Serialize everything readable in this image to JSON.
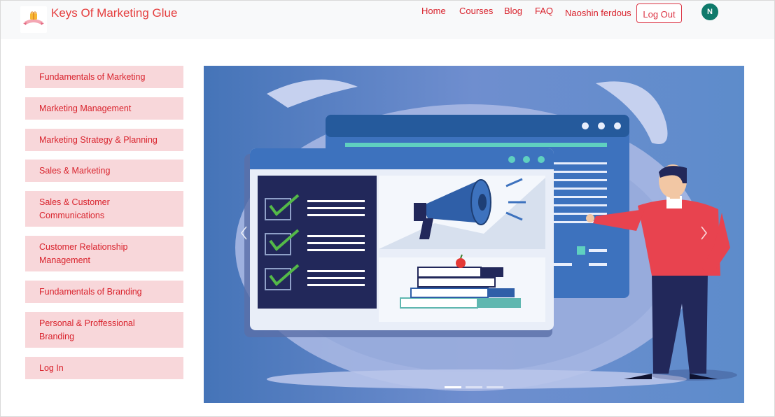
{
  "brand": {
    "name": "Keys Of Marketing Glue",
    "logo_icon": "gift-ribbon-icon"
  },
  "nav": {
    "links": [
      "Home",
      "Courses",
      "Blog",
      "FAQ"
    ],
    "user_name": "Naoshin ferdous",
    "logout_label": "Log Out",
    "avatar_initial": "N"
  },
  "sidebar": {
    "items": [
      {
        "label": "Fundamentals of Marketing"
      },
      {
        "label": "Marketing Management"
      },
      {
        "label": "Marketing Strategy & Planning"
      },
      {
        "label": "Sales & Marketing"
      },
      {
        "label": "Sales & Customer Communications"
      },
      {
        "label": "Customer Relationship Management"
      },
      {
        "label": "Fundamentals of Branding"
      },
      {
        "label": "Personal & Proffessional Branding"
      },
      {
        "label": "Log In"
      }
    ]
  },
  "carousel": {
    "slide_count": 3,
    "active_slide": 1,
    "prev_icon": "chevron-left-icon",
    "next_icon": "chevron-right-icon"
  },
  "colors": {
    "accent": "#dc3545",
    "sidebar_bg": "#f8d7da",
    "avatar_bg": "#0f7a6b",
    "slide_bg": "#5b7fc4"
  }
}
